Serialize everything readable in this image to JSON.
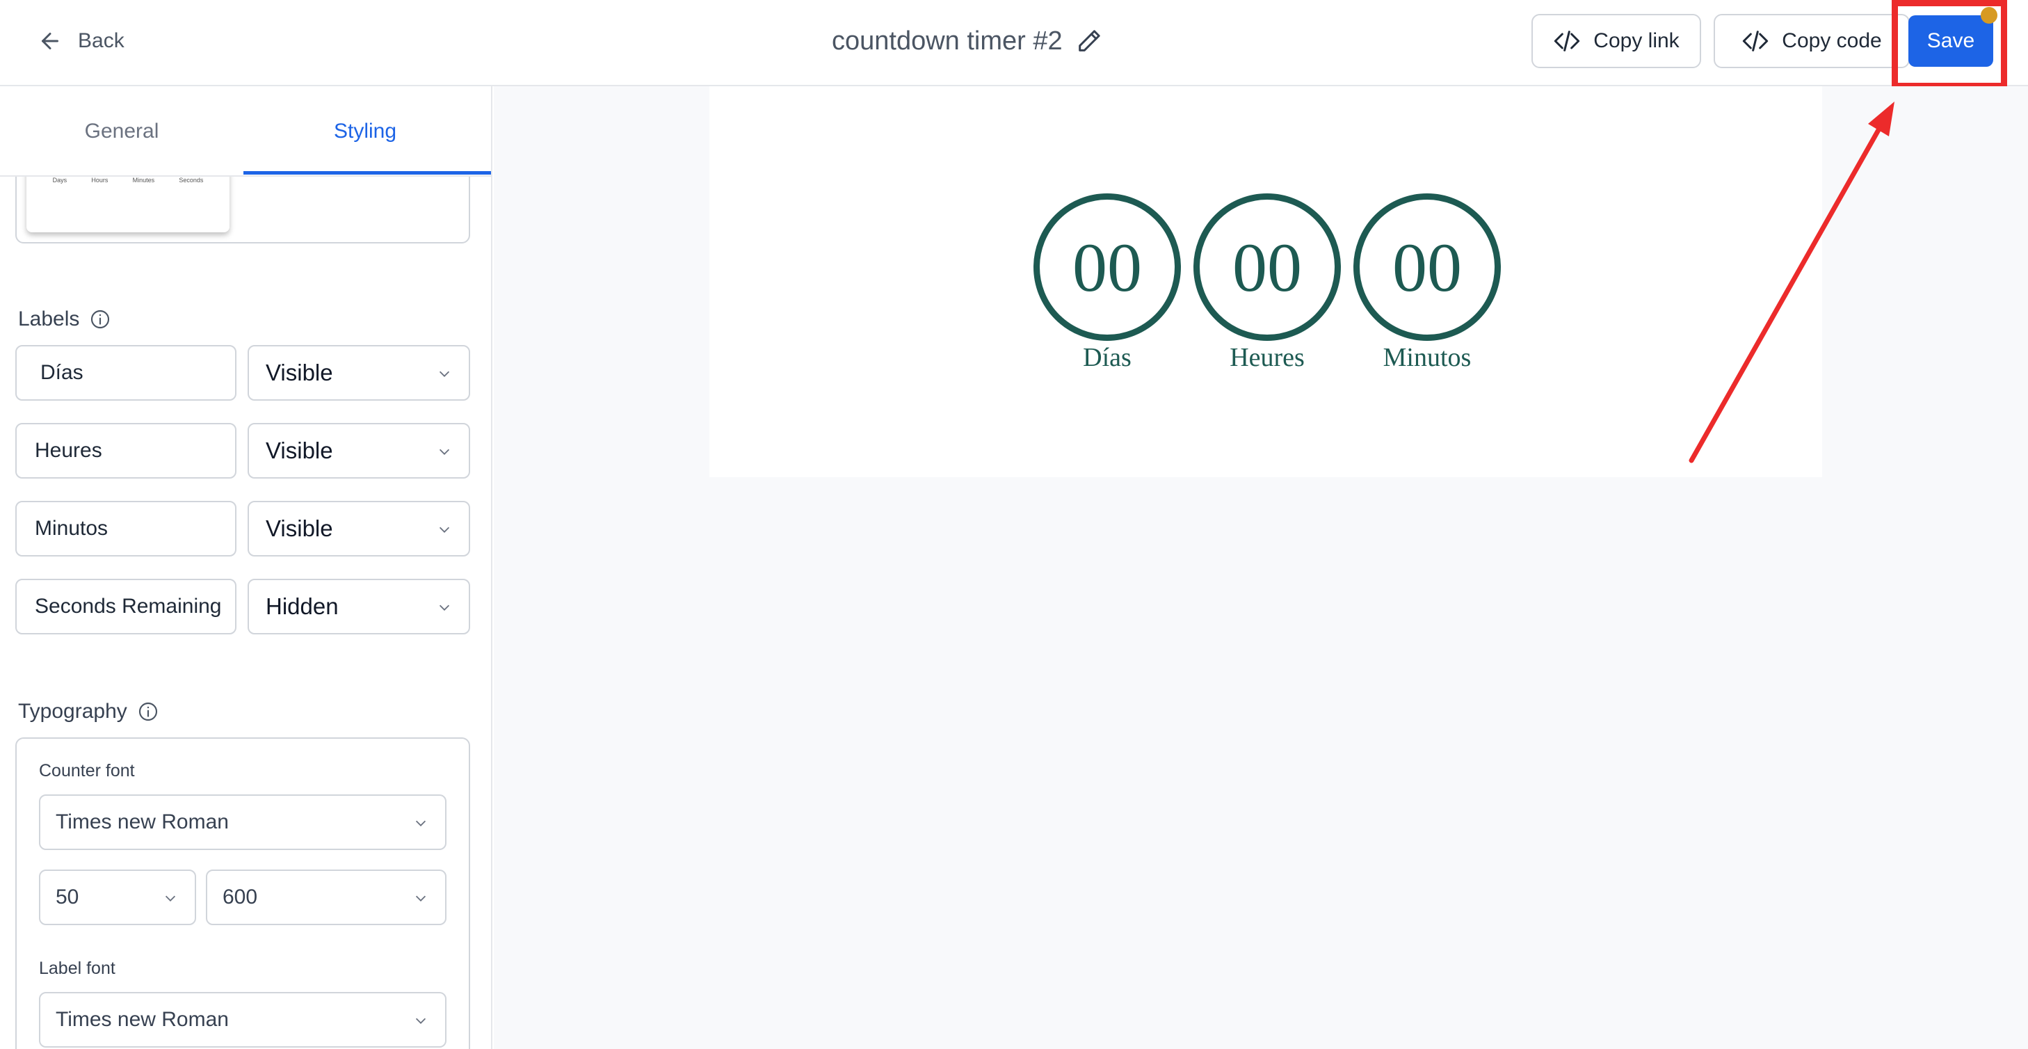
{
  "header": {
    "back_label": "Back",
    "title": "countdown timer #2",
    "copy_link_label": "Copy link",
    "copy_code_label": "Copy code",
    "save_label": "Save"
  },
  "tabs": [
    {
      "label": "General",
      "active": false
    },
    {
      "label": "Styling",
      "active": true
    }
  ],
  "preview_thumbnail": {
    "labels": [
      "Days",
      "Hours",
      "Minutes",
      "Seconds"
    ]
  },
  "labels_section": {
    "title": "Labels",
    "rows": [
      {
        "text": "Días",
        "visibility": "Visible"
      },
      {
        "text": "Heures",
        "visibility": "Visible"
      },
      {
        "text": "Minutos",
        "visibility": "Visible"
      },
      {
        "text": "Seconds Remaining",
        "visibility": "Hidden"
      }
    ]
  },
  "typography": {
    "title": "Typography",
    "counter_font_label": "Counter font",
    "counter_font": "Times new Roman",
    "counter_size": "50",
    "counter_weight": "600",
    "label_font_label": "Label font",
    "label_font": "Times new Roman"
  },
  "timer_preview": {
    "units": [
      {
        "value": "00",
        "label": "Días"
      },
      {
        "value": "00",
        "label": "Heures"
      },
      {
        "value": "00",
        "label": "Minutos"
      }
    ]
  },
  "colors": {
    "accent": "#1d64e6",
    "timer": "#1d5a52",
    "annotation": "#ec2b2b",
    "notification_dot": "#d79a22"
  }
}
